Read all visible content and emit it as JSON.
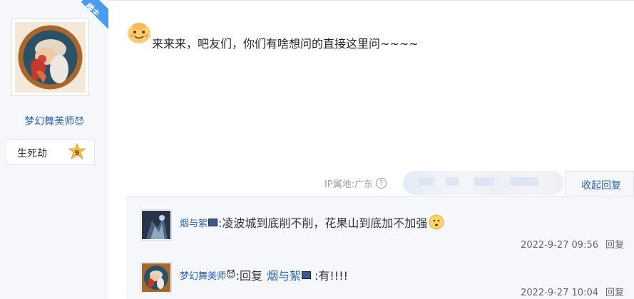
{
  "author": {
    "name": "梦幻舞美师",
    "name_emoji": "😈",
    "badge_corner": "楼主",
    "level_name": "生死劫",
    "level_number": "9"
  },
  "post": {
    "text": "来来来，吧友们，你们有啥想问的直接这里问~~~~",
    "emoji": "smiling-face-emoji"
  },
  "meta": {
    "ip_location": "IP属地:广东",
    "help_icon": "?",
    "collapse_label": "收起回复"
  },
  "replies": [
    {
      "user": "烟与絮",
      "content": ":凌波城到底削不削，花果山到底加不加强",
      "time": "2022-9-27 09:56",
      "reply_label": "回复"
    },
    {
      "user": "梦幻舞美师",
      "user_emoji": "😈",
      "reply_prefix": ":回复",
      "mention": "烟与絮",
      "content": ":有!!!!",
      "time": "2022-9-27 10:04",
      "reply_label": "回复"
    }
  ]
}
